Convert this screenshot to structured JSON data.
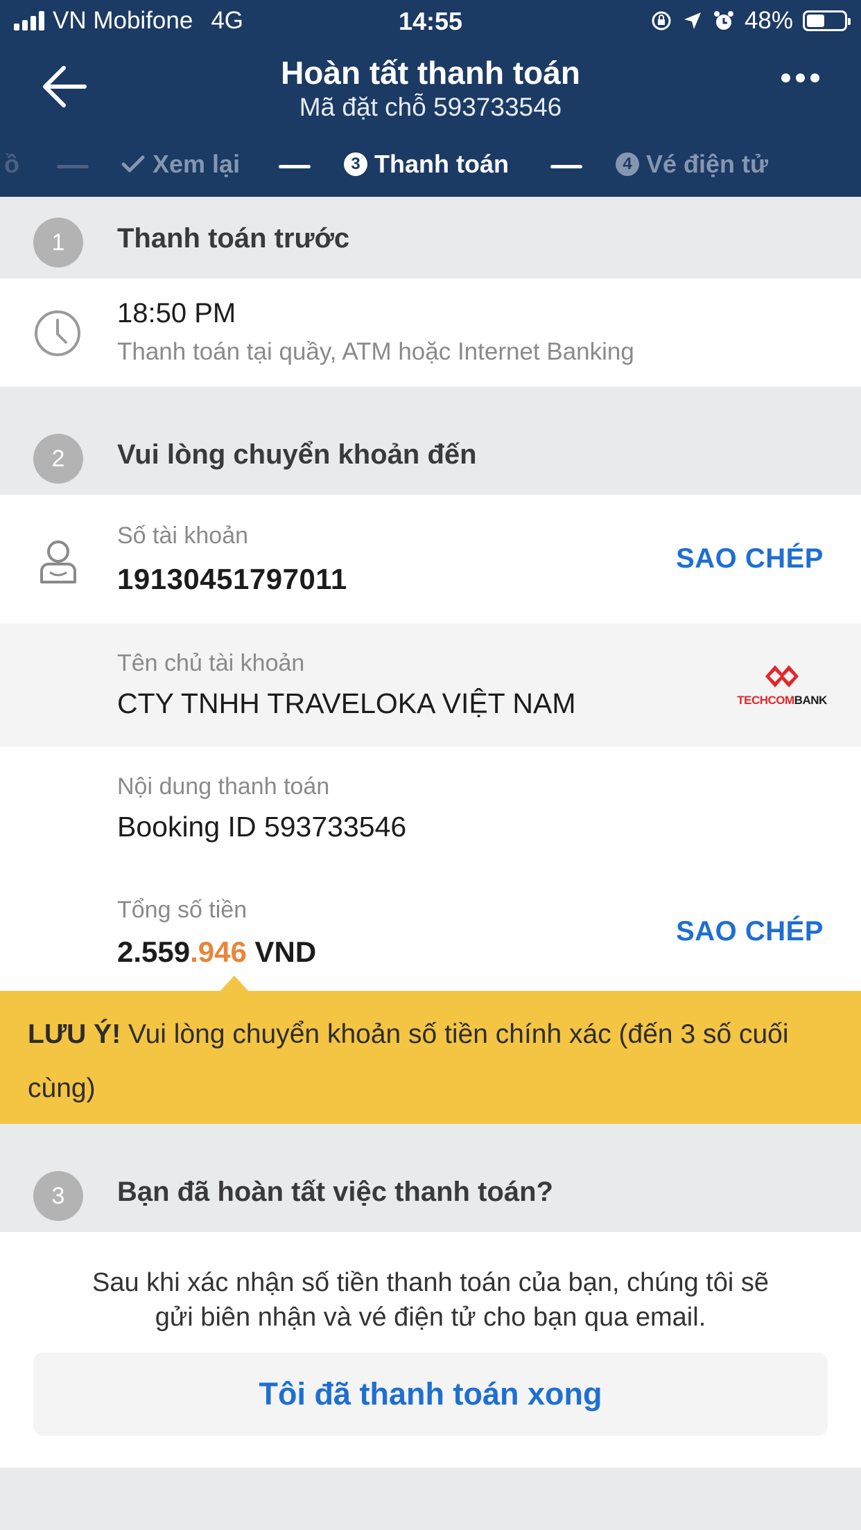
{
  "status": {
    "carrier": "VN Mobifone",
    "network": "4G",
    "time": "14:55",
    "battery": "48%",
    "battery_level": 0.48
  },
  "header": {
    "title": "Hoàn tất thanh toán",
    "subtitle": "Mã đặt chỗ 593733546"
  },
  "steps": {
    "partial_prev": "ồ",
    "review": "Xem lại",
    "pay_num": "3",
    "pay": "Thanh toán",
    "ticket_num": "4",
    "ticket": "Vé điện tử"
  },
  "section1": {
    "num": "1",
    "title": "Thanh toán trước",
    "time": "18:50 PM",
    "desc": "Thanh toán tại quầy, ATM hoặc Internet Banking"
  },
  "section2": {
    "num": "2",
    "title": "Vui lòng chuyển khoản đến",
    "account_label": "Số tài khoản",
    "account_number": "19130451797011",
    "copy_label": "SAO CHÉP",
    "holder_label": "Tên chủ tài khoản",
    "holder_name": "CTY TNHH TRAVELOKA VIỆT NAM",
    "bank_logo_text": "TECHCOMBANK",
    "content_label": "Nội dung thanh toán",
    "content_value": "Booking ID 593733546",
    "total_label": "Tổng số tiền",
    "total_main": "2.559",
    "total_highlight": ".946",
    "total_currency": " VND"
  },
  "notice": {
    "bold": "LƯU Ý!",
    "text": " Vui lòng chuyển khoản số tiền chính xác (đến 3 số cuối cùng)"
  },
  "section3": {
    "num": "3",
    "title": "Bạn đã hoàn tất việc thanh toán?",
    "desc_line1": "Sau khi xác nhận số tiền thanh toán của bạn, chúng tôi sẽ",
    "desc_line2": "gửi biên nhận và vé điện tử cho bạn qua email.",
    "button": "Tôi đã thanh toán xong"
  },
  "colors": {
    "header_bg": "#1b3a64",
    "accent": "#1e6fd1",
    "highlight": "#e8863a",
    "notice_bg": "#f4c443"
  }
}
